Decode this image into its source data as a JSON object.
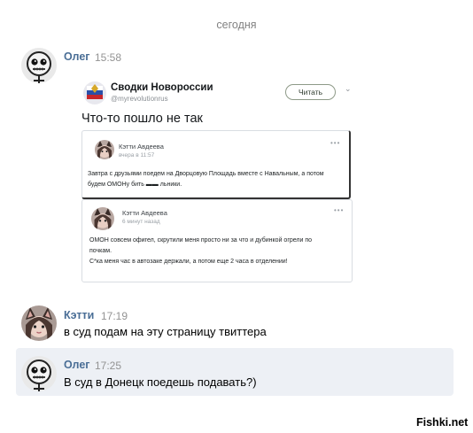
{
  "date_separator": "сегодня",
  "messages": [
    {
      "author": "Олег",
      "time": "15:58",
      "avatar": "skull-face-avatar",
      "attachment": {
        "channel": "Сводки Новороссии",
        "handle": "@myrevolutionrus",
        "follow_label": "Читать",
        "tweet_text": "Что-то пошло не так",
        "quoted": [
          {
            "author": "Кэтти Авдеева",
            "time": "вчера в 11:57",
            "lines": [
              "Завтра с друзьями поедем на Дворцовую Площадь вместе с Навальным, а потом",
              "будем ОМОНу бить ▬▬ льники."
            ]
          },
          {
            "author": "Кэтти Авдеева",
            "time": "6 минут назад",
            "lines": [
              "ОМОН совсем офигел, скрутили меня просто ни за что и дубинкой огрели по",
              "почкам.",
              "С*ка меня час в автозаке держали, а потом еще 2 часа в отделении!"
            ]
          }
        ]
      }
    },
    {
      "author": "Кэтти",
      "time": "17:19",
      "avatar": "cat-girl-avatar",
      "text": "в суд подам на эту страницу твиттера"
    },
    {
      "author": "Олег",
      "time": "17:25",
      "avatar": "skull-face-avatar",
      "text": "В суд в Донецк поедешь подавать?)"
    }
  ],
  "watermark": "Fishki.net",
  "colors": {
    "author_name": "#4a6e96",
    "time": "#939393",
    "highlight_bg": "#edf0f5"
  }
}
